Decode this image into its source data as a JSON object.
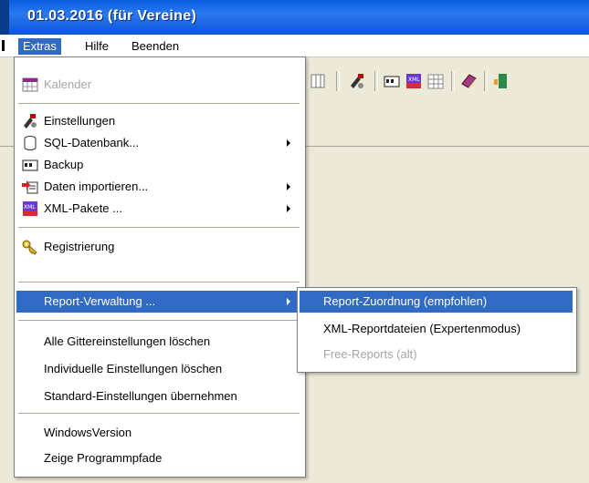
{
  "window": {
    "title": "01.03.2016 (für Vereine)"
  },
  "menubar": {
    "extras": "Extras",
    "hilfe": "Hilfe",
    "beenden": "Beenden"
  },
  "extras_menu": {
    "kalender": "Kalender",
    "einstellungen": "Einstellungen",
    "sql_datenbank": "SQL-Datenbank...",
    "backup": "Backup",
    "daten_importieren": "Daten importieren...",
    "xml_pakete": "XML-Pakete ...",
    "registrierung": "Registrierung",
    "report_verwaltung": "Report-Verwaltung ...",
    "gitter_loeschen": "Alle Gittereinstellungen löschen",
    "individuelle_loeschen": "Individuelle Einstellungen löschen",
    "standard_uebernehmen": "Standard-Einstellungen übernehmen",
    "windowsversion": "WindowsVersion",
    "programmpfade": "Zeige Programmpfade"
  },
  "report_submenu": {
    "zuordnung": "Report-Zuordnung (empfohlen)",
    "xml_reportdateien": "XML-Reportdateien (Expertenmodus)",
    "free_reports": "Free-Reports (alt)"
  },
  "colors": {
    "title_blue": "#0a5fe0",
    "highlight": "#316ac5",
    "disabled": "#a5a5a5"
  }
}
